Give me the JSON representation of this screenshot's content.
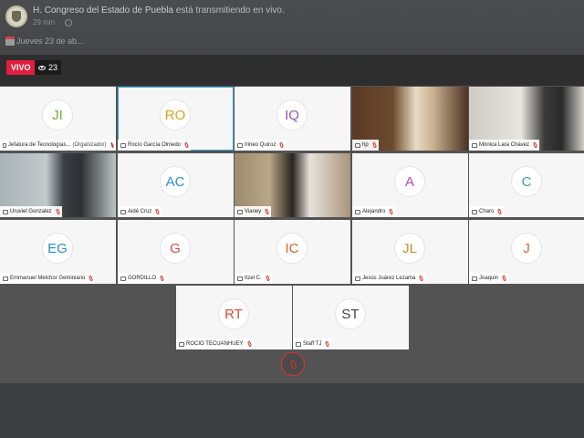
{
  "post": {
    "page_name": "H. Congreso del Estado de Puebla",
    "action": "está transmitiendo en vivo.",
    "time": "29 min",
    "text": "Jueves 23 de ab..."
  },
  "live": {
    "badge": "VIVO",
    "viewers": "23"
  },
  "colors": {
    "live_red": "#e41e3f",
    "active_border": "#34a3d8",
    "mic_muted": "#d9342b"
  },
  "participants": [
    {
      "initials": "JI",
      "name": "Jefatura de Tecnologías...",
      "tag": "(Organizador)",
      "color": "#6fae3c",
      "camera": false
    },
    {
      "initials": "RO",
      "name": "Rocío  García Olmedo",
      "tag": "",
      "color": "#e0a11b",
      "camera": false,
      "active": true
    },
    {
      "initials": "IQ",
      "name": "Irineo Quiroz",
      "tag": "",
      "color": "#8b5db5",
      "camera": false
    },
    {
      "initials": "",
      "name": "hp",
      "tag": "",
      "color": "",
      "camera": true
    },
    {
      "initials": "",
      "name": "Mónica Lara Chávez",
      "tag": "",
      "color": "",
      "camera": true
    },
    {
      "initials": "",
      "name": "Uruviel Gonzalez",
      "tag": "",
      "color": "",
      "camera": true
    },
    {
      "initials": "AC",
      "name": "Aidé Cruz",
      "tag": "",
      "color": "#2f8ec9",
      "camera": false
    },
    {
      "initials": "",
      "name": "Vianey",
      "tag": "",
      "color": "",
      "camera": true
    },
    {
      "initials": "A",
      "name": "Alejandro",
      "tag": "",
      "color": "#b34aa3",
      "camera": false
    },
    {
      "initials": "C",
      "name": "Charo",
      "tag": "",
      "color": "#3aa29a",
      "camera": false
    },
    {
      "initials": "EG",
      "name": "Emmanuel Melchor Geminiano",
      "tag": "",
      "color": "#2f8ec9",
      "camera": false
    },
    {
      "initials": "G",
      "name": "GORDILLO",
      "tag": "",
      "color": "#d94b3b",
      "camera": false
    },
    {
      "initials": "IC",
      "name": "Itzel C.",
      "tag": "",
      "color": "#d9642b",
      "camera": false
    },
    {
      "initials": "JL",
      "name": "Jesús Juárez Lezama",
      "tag": "",
      "color": "#c8902a",
      "camera": false
    },
    {
      "initials": "J",
      "name": "Joaquin",
      "tag": "",
      "color": "#d9642b",
      "camera": false
    },
    {
      "initials": "RT",
      "name": "ROCIO TECUANHUEY",
      "tag": "",
      "color": "#d94b3b",
      "camera": false
    },
    {
      "initials": "ST",
      "name": "Staff TJ",
      "tag": "",
      "color": "#444444",
      "camera": false
    }
  ]
}
